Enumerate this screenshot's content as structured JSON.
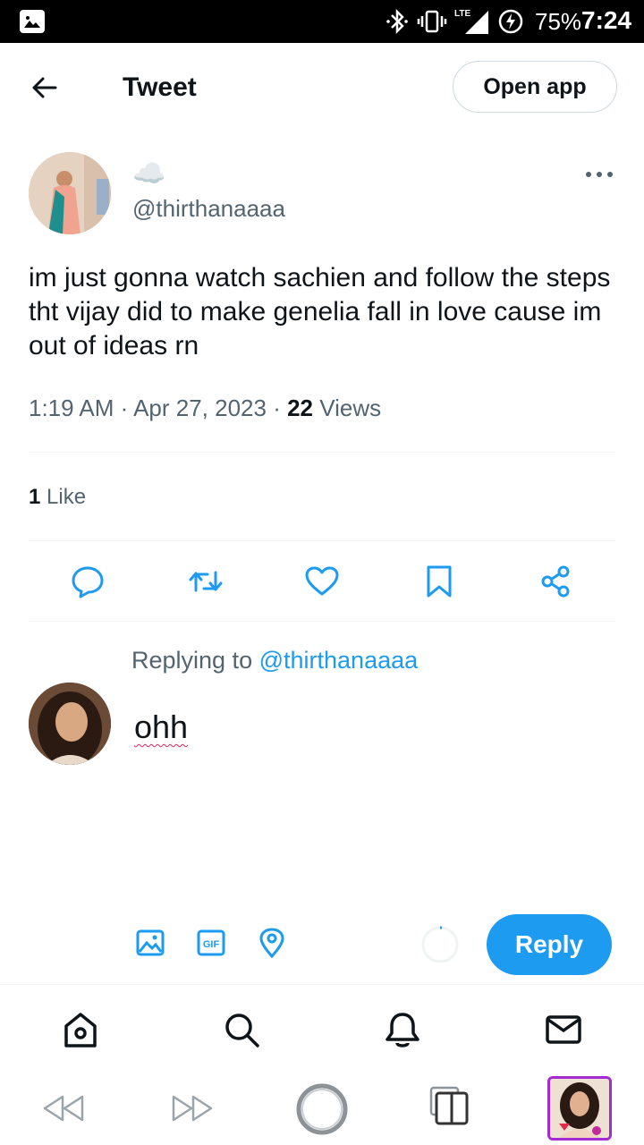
{
  "status_bar": {
    "network": "LTE",
    "battery_percent": "75%",
    "time": "7:24",
    "icons": [
      "gallery-icon",
      "bluetooth-icon",
      "vibrate-icon",
      "signal-icon",
      "data-saver-icon"
    ]
  },
  "header": {
    "title": "Tweet",
    "open_app_label": "Open app"
  },
  "tweet": {
    "author_display_emoji": "☁️",
    "author_handle": "@thirthanaaaa",
    "text": "im just gonna watch sachien and follow the steps tht vijay did to make genelia fall in love cause im out of ideas rn",
    "time": "1:19 AM",
    "date": "Apr 27, 2023",
    "views_count": "22",
    "views_label": "Views",
    "likes_count": "1",
    "likes_label": "Like"
  },
  "actions": [
    "reply-icon",
    "retweet-icon",
    "like-icon",
    "bookmark-icon",
    "share-icon"
  ],
  "compose": {
    "replying_prefix": "Replying to",
    "replying_to": "@thirthanaaaa",
    "draft_text": "ohh",
    "reply_button_label": "Reply",
    "tools": [
      "image-icon",
      "gif-icon",
      "location-icon"
    ]
  },
  "bottom_nav": [
    "home-icon",
    "search-icon",
    "notifications-icon",
    "messages-icon"
  ],
  "browser_bar": [
    "rewind-icon",
    "forward-icon",
    "circle-icon",
    "tabs-icon",
    "thumbnail"
  ],
  "colors": {
    "accent": "#1d9bf0",
    "text_primary": "#0f1419",
    "text_secondary": "#536471",
    "divider": "#eff3f4",
    "thumb_border": "#a22bd1"
  }
}
